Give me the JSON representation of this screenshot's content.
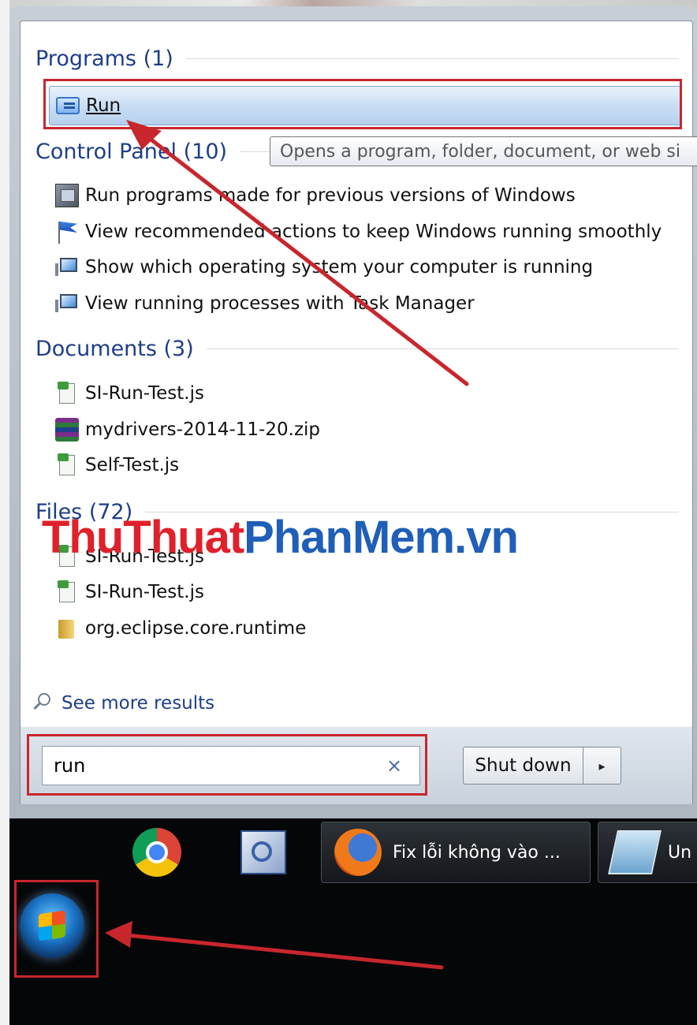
{
  "start_menu": {
    "sections": {
      "programs": {
        "title": "Programs (1)"
      },
      "control_panel": {
        "title": "Control Panel (10)"
      },
      "documents": {
        "title": "Documents (3)"
      },
      "files": {
        "title": "Files (72)"
      }
    },
    "programs_items": [
      {
        "label": "Run",
        "icon": "run-icon",
        "selected": true
      }
    ],
    "control_panel_items": [
      {
        "label": "Run programs made for previous versions of Windows",
        "icon": "compatibility-icon"
      },
      {
        "label": "View recommended actions to keep Windows running smoothly",
        "icon": "action-center-flag-icon"
      },
      {
        "label": "Show which operating system your computer is running",
        "icon": "system-monitor-icon"
      },
      {
        "label": "View running processes with Task Manager",
        "icon": "system-monitor-icon"
      }
    ],
    "documents_items": [
      {
        "label": "SI-Run-Test.js",
        "icon": "js-file-icon"
      },
      {
        "label": "mydrivers-2014-11-20.zip",
        "icon": "winrar-archive-icon"
      },
      {
        "label": "Self-Test.js",
        "icon": "js-file-icon"
      }
    ],
    "files_items": [
      {
        "label": "SI-Run-Test.js",
        "icon": "js-file-icon"
      },
      {
        "label": "SI-Run-Test.js",
        "icon": "js-file-icon"
      },
      {
        "label": "org.eclipse.core.runtime",
        "icon": "folder-icon"
      }
    ],
    "tooltip": "Opens a program, folder, document, or web si",
    "see_more": "See more results",
    "search": {
      "value": "run",
      "clear_icon": "×"
    },
    "shutdown": {
      "label": "Shut down",
      "arrow": "▸"
    }
  },
  "watermark": {
    "part1": "ThuThuat",
    "part2": "PhanMem.vn",
    "color1": "#e0202a",
    "color2": "#1f5fb8"
  },
  "taskbar": {
    "pinned": [
      "chrome-icon",
      "quick-assist-icon"
    ],
    "tasks": [
      {
        "label": "Fix lỗi không vào ...",
        "icon": "firefox-icon"
      },
      {
        "label": "Un",
        "icon": "notepad-icon"
      }
    ]
  },
  "annotation_color": "#c8262d"
}
